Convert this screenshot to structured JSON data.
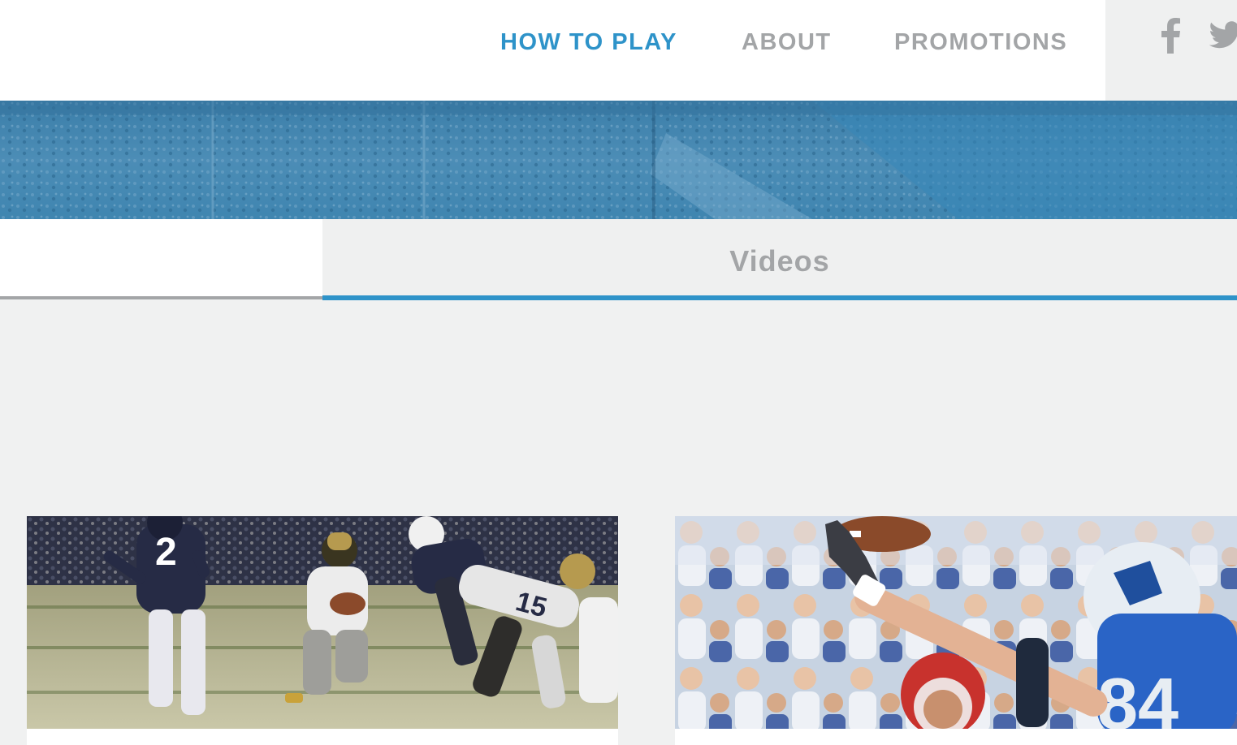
{
  "header": {
    "nav": [
      {
        "label": "HOW TO PLAY",
        "active": true
      },
      {
        "label": "ABOUT",
        "active": false
      },
      {
        "label": "PROMOTIONS",
        "active": false
      }
    ],
    "social": [
      "facebook-icon",
      "twitter-icon"
    ]
  },
  "tabs": {
    "active_label": "Videos"
  },
  "colors": {
    "accent": "#2e93c9",
    "nav_inactive": "#a3a5a7",
    "background": "#f0f1f1"
  }
}
